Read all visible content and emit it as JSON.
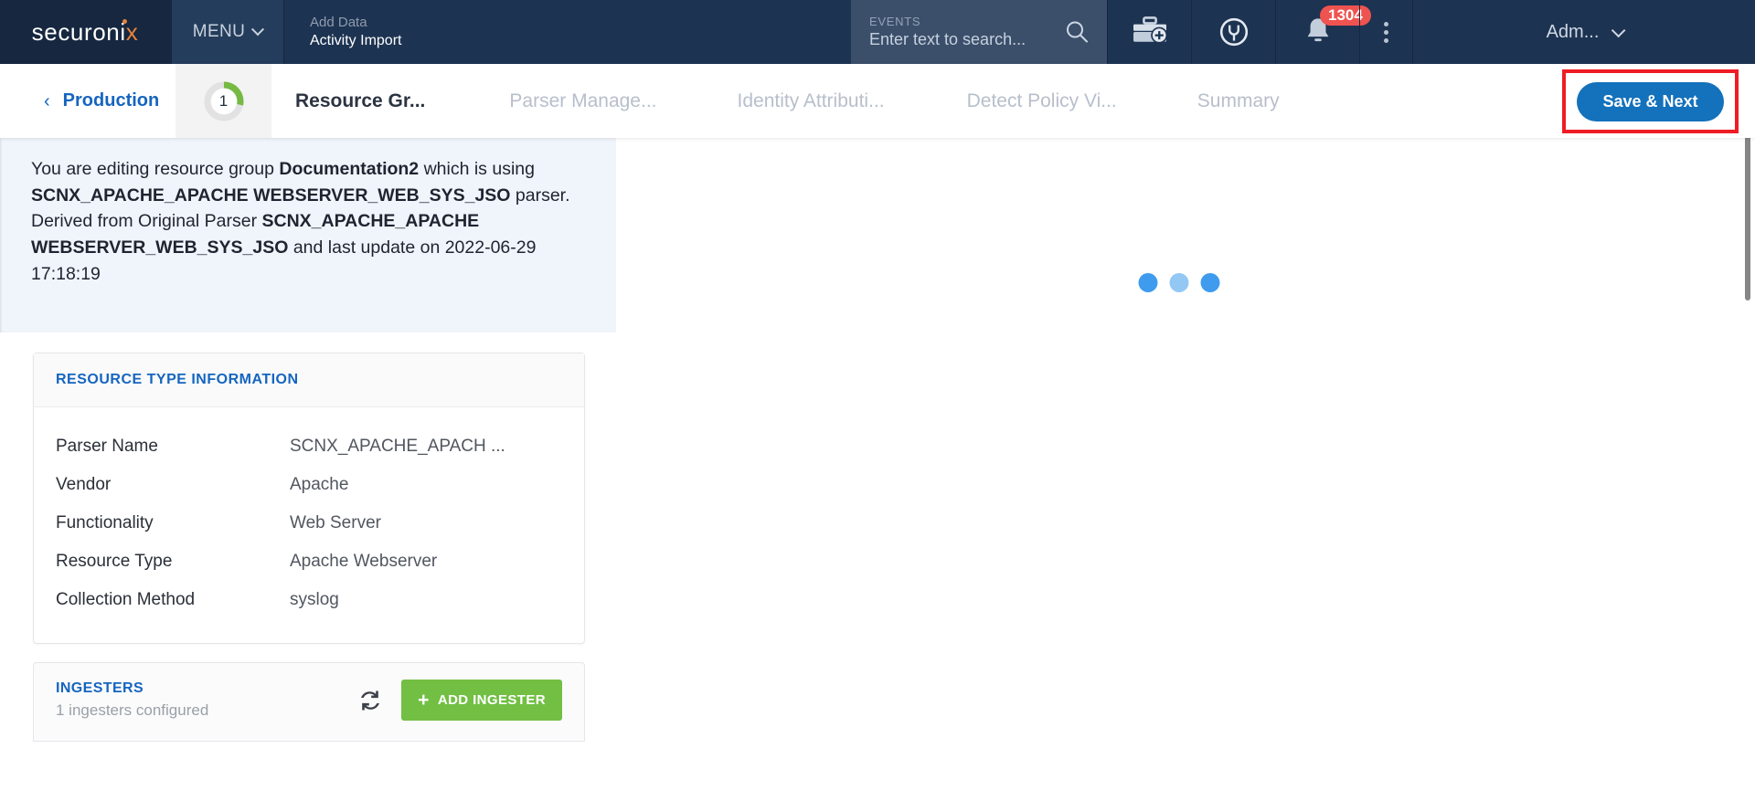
{
  "header": {
    "logo": "securoni",
    "logo_accent": "x",
    "menu_label": "MENU",
    "breadcrumb_top": "Add Data",
    "breadcrumb_bottom": "Activity Import",
    "search": {
      "scope_label": "EVENTS",
      "placeholder": "Enter text to search...",
      "icon": "search-icon"
    },
    "icons": {
      "toolbox": "toolbox-add-icon",
      "spy": "spotter-icon",
      "bell": "notification-bell-icon",
      "kebab": "more-options-icon"
    },
    "notification_count": "1304",
    "user_label": "Adm..."
  },
  "stepbar": {
    "back_arrow": "‹",
    "back_label": "Production",
    "progress_number": "1",
    "progress_percent": 28,
    "progress_color": "#76b943",
    "steps": [
      {
        "label": "Resource Gr...",
        "active": true
      },
      {
        "label": "Parser Manage...",
        "active": false
      },
      {
        "label": "Identity Attributi...",
        "active": false
      },
      {
        "label": "Detect Policy Vi...",
        "active": false
      },
      {
        "label": "Summary",
        "active": false
      }
    ],
    "save_label": "Save & Next",
    "highlight_color": "#ee1c25",
    "save_color": "#1471bb"
  },
  "banner": {
    "p1": "You are editing resource group ",
    "b1": "Documentation2",
    "p2": " which is using ",
    "b2": "SCNX_APACHE_APACHE WEBSERVER_WEB_SYS_JSO",
    "p3": " parser. Derived from Original Parser ",
    "b3": "SCNX_APACHE_APACHE WEBSERVER_WEB_SYS_JSO",
    "p4": " and last update on 2022-06-29 17:18:19"
  },
  "resource_card": {
    "title": "RESOURCE TYPE INFORMATION",
    "rows": [
      {
        "key": "Parser Name",
        "value": "SCNX_APACHE_APACH  ..."
      },
      {
        "key": "Vendor",
        "value": "Apache"
      },
      {
        "key": "Functionality",
        "value": "Web Server"
      },
      {
        "key": "Resource Type",
        "value": "Apache Webserver"
      },
      {
        "key": "Collection Method",
        "value": "syslog"
      }
    ]
  },
  "ingesters": {
    "title": "INGESTERS",
    "subtitle": "1 ingesters configured",
    "refresh_icon": "refresh-icon",
    "add_plus": "+",
    "add_label": "ADD INGESTER",
    "add_color": "#72bf44"
  },
  "main": {
    "loading_state": "loading",
    "dots": 3
  }
}
